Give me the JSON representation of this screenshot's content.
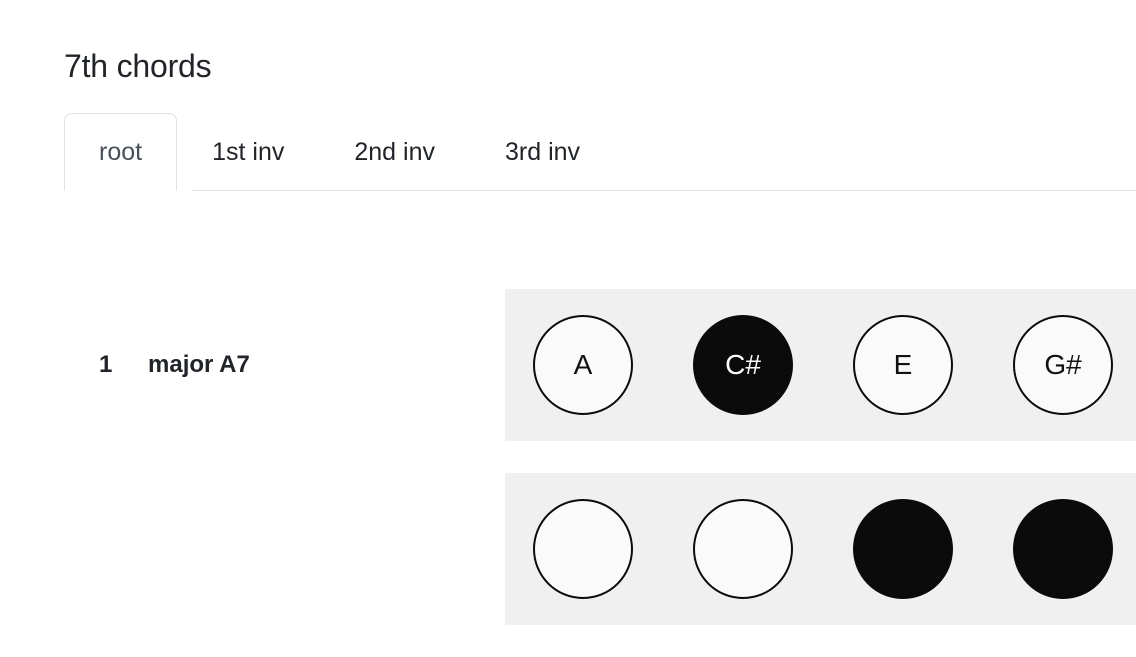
{
  "page": {
    "title": "7th chords",
    "background_color": "#ffffff"
  },
  "tabs": {
    "active_index": 0,
    "items": [
      {
        "label": "root",
        "active": true
      },
      {
        "label": "1st inv",
        "active": false
      },
      {
        "label": "2nd inv",
        "active": false
      },
      {
        "label": "3rd inv",
        "active": false
      }
    ],
    "active_text_color": "#495057",
    "inactive_text_color": "#212529",
    "border_color": "#dee2e6"
  },
  "chords": {
    "band_color": "#f0f0f0",
    "note_white_fill": "#fafafa",
    "note_black_fill": "#0b0b0b",
    "rows": [
      {
        "index": "1",
        "name": "major A7",
        "notes": [
          {
            "label": "A",
            "accidental": false
          },
          {
            "label": "C#",
            "accidental": true
          },
          {
            "label": "E",
            "accidental": false
          },
          {
            "label": "G#",
            "accidental": true
          }
        ]
      },
      {
        "index": "",
        "name": "",
        "notes": [
          {
            "label": "",
            "accidental": false
          },
          {
            "label": "",
            "accidental": false
          },
          {
            "label": "",
            "accidental": true
          },
          {
            "label": "",
            "accidental": true
          }
        ]
      }
    ]
  }
}
